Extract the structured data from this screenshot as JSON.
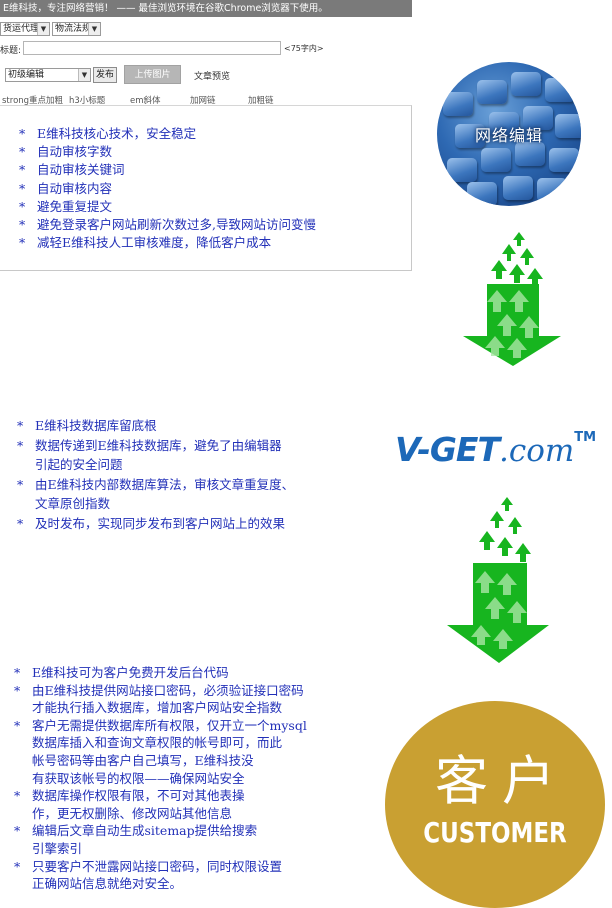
{
  "editor": {
    "banner": "E维科技，专注网络营销！ —— 最佳浏览环境在谷歌Chrome浏览器下使用。",
    "selects": [
      "货运代理",
      "物流法规"
    ],
    "title_label": "标题:",
    "title_hint": "<75字内>",
    "mode_select": "初级编辑",
    "publish_button": "发布",
    "upload_button": "上传图片",
    "preview_button": "文章预览",
    "toolbar": [
      "strong重点加粗",
      "h3小标题",
      "em斜体",
      "加网链",
      "加粗链"
    ]
  },
  "section1": {
    "items": [
      [
        "E维科技核心技术，安全稳定"
      ],
      [
        "自动审核字数"
      ],
      [
        "自动审核关键词"
      ],
      [
        "自动审核内容"
      ],
      [
        "避免重复提文"
      ],
      [
        "避免登录客户网站刷新次数过多,导致网站访问变慢"
      ],
      [
        "减轻E维科技人工审核难度，降低客户成本"
      ]
    ]
  },
  "keyboard_badge": {
    "label": "网络编辑"
  },
  "section2": {
    "items": [
      [
        "E维科技数据库留底根"
      ],
      [
        "数据传递到E维科技数据库，避免了由编辑器",
        "引起的安全问题"
      ],
      [
        "由E维科技内部数据库算法，审核文章重复度、",
        "文章原创指数"
      ],
      [
        "及时发布，实现同步发布到客户网站上的效果"
      ]
    ]
  },
  "logo": {
    "brand": "V-GET",
    "suffix": ".com",
    "tm": "TM"
  },
  "section3": {
    "items": [
      [
        "E维科技可为客户免费开发后台代码"
      ],
      [
        "由E维科技提供网站接口密码，必须验证接口密码",
        "才能执行插入数据库，增加客户网站安全指数"
      ],
      [
        "客户无需提供数据库所有权限，仅开立一个mysql",
        "数据库插入和查询文章权限的帐号即可，而此",
        "帐号密码等由客户自己填写，E维科技没",
        "有获取该帐号的权限——确保网站安全"
      ],
      [
        "数据库操作权限有限，不可对其他表操",
        "作，更无权删除、修改网站其他信息"
      ],
      [
        "编辑后文章自动生成sitemap提供给搜索",
        "引擎索引"
      ],
      [
        "只要客户不泄露网站接口密码，同时权限设置",
        "正确网站信息就绝对安全。"
      ]
    ]
  },
  "customer_badge": {
    "cn": "客户",
    "en": "CUSTOMER"
  },
  "bullet": "*",
  "colors": {
    "text_blue": "#2230b8",
    "arrow_green": "#17b51f",
    "badge_gold": "#c9a032",
    "logo_blue": "#1c68b8"
  },
  "icons": [
    "keyboard-image",
    "green-down-arrow-icon",
    "vget-logo",
    "customer-badge"
  ]
}
